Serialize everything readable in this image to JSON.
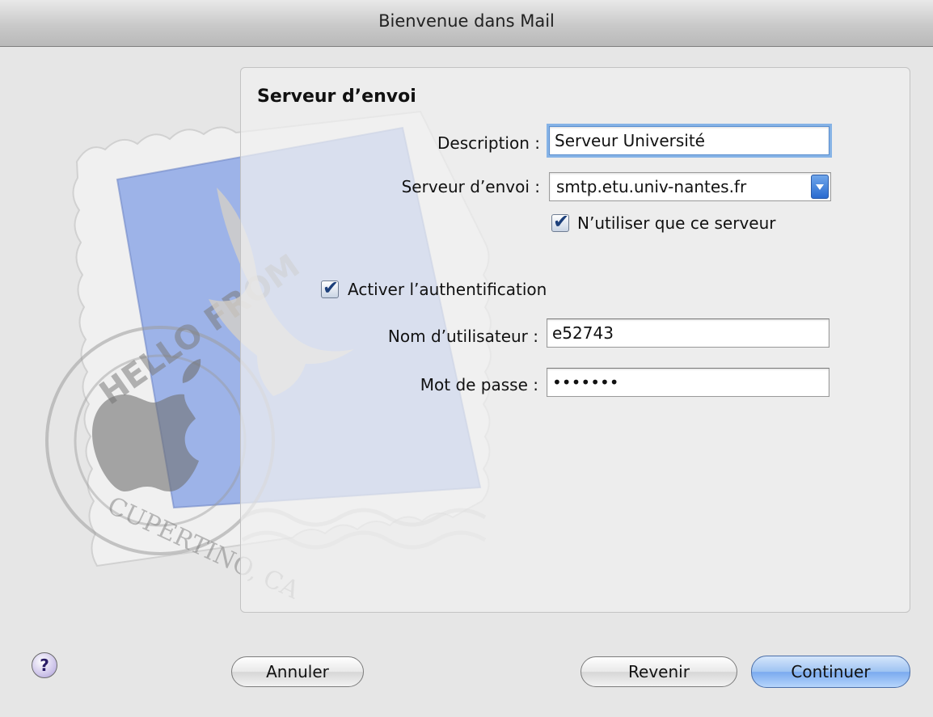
{
  "window": {
    "title": "Bienvenue dans Mail"
  },
  "artwork": {
    "postmark_text": "HELLO FROM",
    "postmark_city": "CUPERTINO, CA"
  },
  "form": {
    "section_title": "Serveur d’envoi",
    "description_label": "Description :",
    "description_value": "Serveur Université",
    "server_label": "Serveur d’envoi :",
    "server_value": "smtp.etu.univ-nantes.fr",
    "only_this_server_label": "N’utiliser que ce serveur",
    "only_this_server_checked": true,
    "enable_auth_label": "Activer l’authentification",
    "enable_auth_checked": true,
    "username_label": "Nom d’utilisateur :",
    "username_value": "e52743",
    "password_label": "Mot de passe :",
    "password_value": "•••••••"
  },
  "buttons": {
    "help_label": "?",
    "cancel_label": "Annuler",
    "back_label": "Revenir",
    "continue_label": "Continuer"
  },
  "colors": {
    "accent": "#7aaaef",
    "stamp_blue": "#7f99d9"
  },
  "icons": {
    "checkbox_checked": "checkmark",
    "dropdown": "chevron-down",
    "help": "question-mark"
  }
}
